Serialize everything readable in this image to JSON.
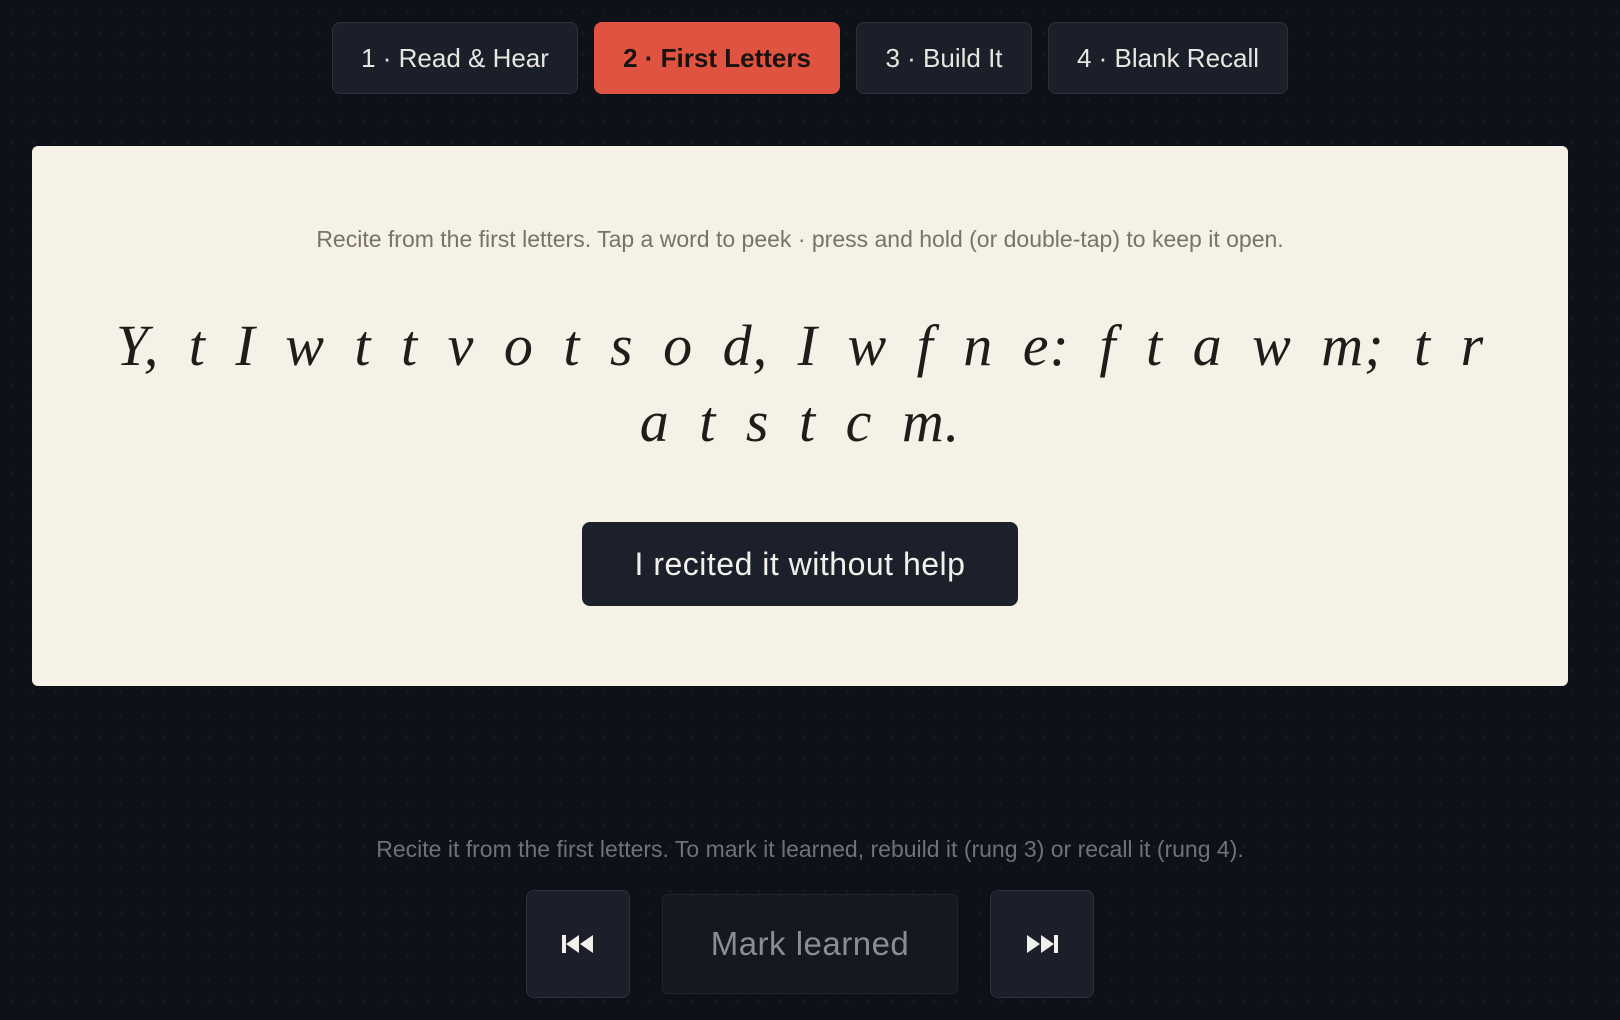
{
  "tabs": [
    {
      "label": "1 · Read & Hear",
      "active": false
    },
    {
      "label": "2 · First Letters",
      "active": true
    },
    {
      "label": "3 · Build It",
      "active": false
    },
    {
      "label": "4 · Blank Recall",
      "active": false
    }
  ],
  "card": {
    "instruction": "Recite from the first letters. Tap a word to peek · press and hold (or double-tap) to keep it open.",
    "letters": [
      "Y,",
      "t",
      "I",
      "w",
      "t",
      "t",
      "v",
      "o",
      "t",
      "s",
      "o",
      "d,",
      "I",
      "w",
      "f",
      "n",
      "e:",
      "f",
      "t",
      "a",
      "w",
      "m;",
      "t",
      "r",
      "a",
      "t",
      "s",
      "t",
      "c",
      "m."
    ],
    "recite_button_label": "I recited it without help"
  },
  "footer": {
    "hint": "Recite it from the first letters. To mark it learned, rebuild it (rung 3) or recall it (rung 4).",
    "prev_icon": "skip-back-icon",
    "next_icon": "skip-forward-icon",
    "mark_learned_label": "Mark learned"
  },
  "colors": {
    "background": "#0e1117",
    "accent": "#e05340",
    "card": "#f5f1e7",
    "button_dark": "#1c202b"
  }
}
